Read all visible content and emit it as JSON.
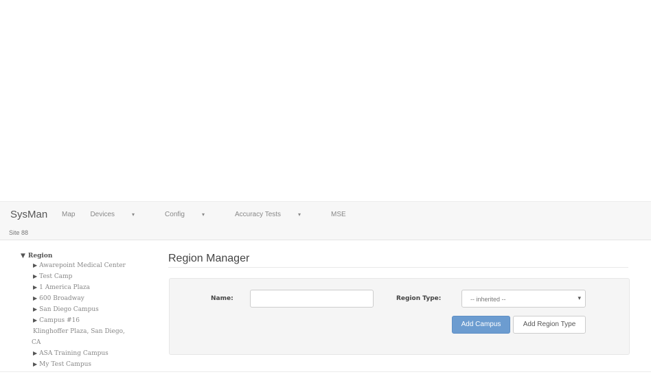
{
  "app": {
    "brand": "SysMan",
    "site": "Site 88"
  },
  "nav": {
    "map": "Map",
    "devices": "Devices",
    "config": "Config",
    "accuracy_tests": "Accuracy Tests",
    "mse": "MSE",
    "caret": "▾"
  },
  "tree": {
    "root": "Region",
    "items": [
      "Awarepoint Medical Center",
      "Test Camp",
      "1 America Plaza",
      "600 Broadway",
      "San Diego Campus",
      "Campus #16"
    ],
    "wrapped_line1": "Klinghoffer Plaza, San Diego,",
    "wrapped_line2": "CA",
    "items2": [
      "ASA Training Campus",
      "My Test Campus"
    ]
  },
  "main": {
    "title": "Region Manager",
    "name_label": "Name:",
    "name_value": "",
    "region_type_label": "Region Type:",
    "region_type_selected": "-- inherited --",
    "add_campus": "Add Campus",
    "add_region_type": "Add Region Type"
  },
  "icons": {
    "expanded": "triangle-down-icon",
    "collapsed": "triangle-right-icon",
    "select": "chevron-down-icon"
  },
  "colors": {
    "primary_button": "#6c9cd0",
    "navbar_bg": "#f7f7f7",
    "panel_bg": "#f5f5f5"
  }
}
